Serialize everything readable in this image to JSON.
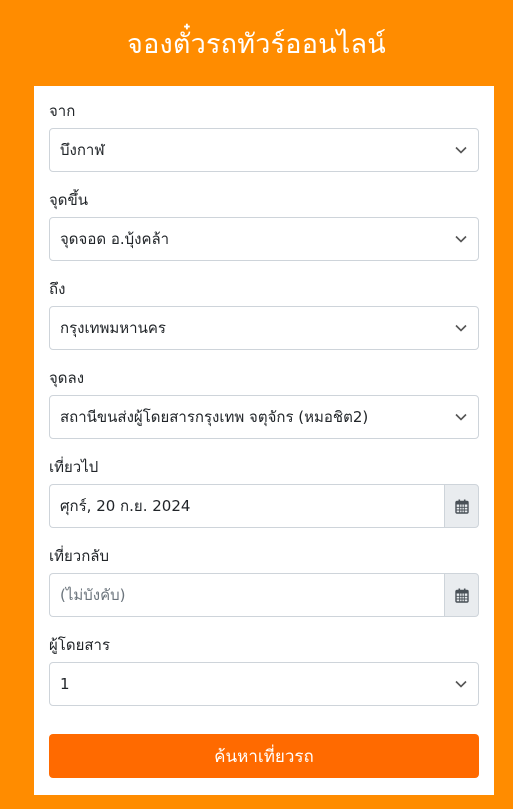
{
  "header": {
    "title": "จองตั๋วรถทัวร์ออนไลน์"
  },
  "form": {
    "from": {
      "label": "จาก",
      "value": "บึงกาฬ"
    },
    "pickup": {
      "label": "จุดขึ้น",
      "value": "จุดจอด อ.บุ้งคล้า"
    },
    "to": {
      "label": "ถึง",
      "value": "กรุงเทพมหานคร"
    },
    "dropoff": {
      "label": "จุดลง",
      "value": "สถานีขนส่งผู้โดยสารกรุงเทพ จตุจักร (หมอชิต2)"
    },
    "depart": {
      "label": "เที่ยวไป",
      "value": "ศุกร์, 20 ก.ย. 2024"
    },
    "return": {
      "label": "เที่ยวกลับ",
      "placeholder": "(ไม่บังคับ)"
    },
    "passengers": {
      "label": "ผู้โดยสาร",
      "value": "1"
    }
  },
  "search_button": {
    "label": "ค้นหาเที่ยวรถ"
  },
  "icons": {
    "select_caret": "chevron-down-icon",
    "date_picker": "calendar-icon"
  },
  "colors": {
    "background": "#ff8c00",
    "button": "#ff6a00",
    "card": "#ffffff"
  }
}
